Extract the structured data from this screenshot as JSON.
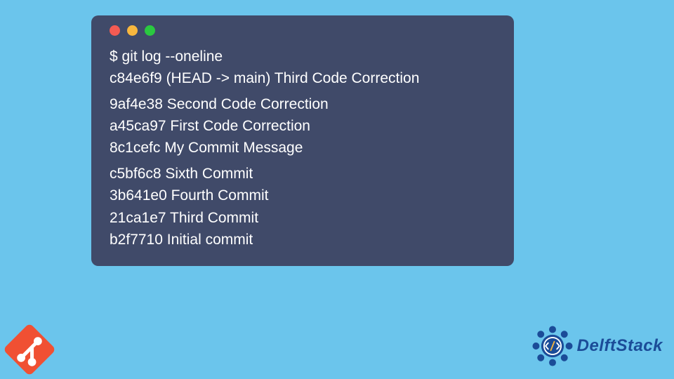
{
  "terminal": {
    "command": "$ git log --oneline",
    "groups": [
      [
        "c84e6f9 (HEAD -> main) Third Code Correction"
      ],
      [
        "9af4e38 Second Code Correction",
        "a45ca97 First Code Correction",
        "8c1cefc My Commit Message"
      ],
      [
        "c5bf6c8 Sixth Commit",
        "3b641e0 Fourth Commit",
        "21ca1e7 Third Commit",
        "b2f7710 Initial commit"
      ]
    ]
  },
  "branding": {
    "delft_text": "DelftStack"
  },
  "colors": {
    "bg": "#6bc5ec",
    "terminal": "#404a69",
    "git": "#f05033",
    "delft": "#1b4c98"
  }
}
